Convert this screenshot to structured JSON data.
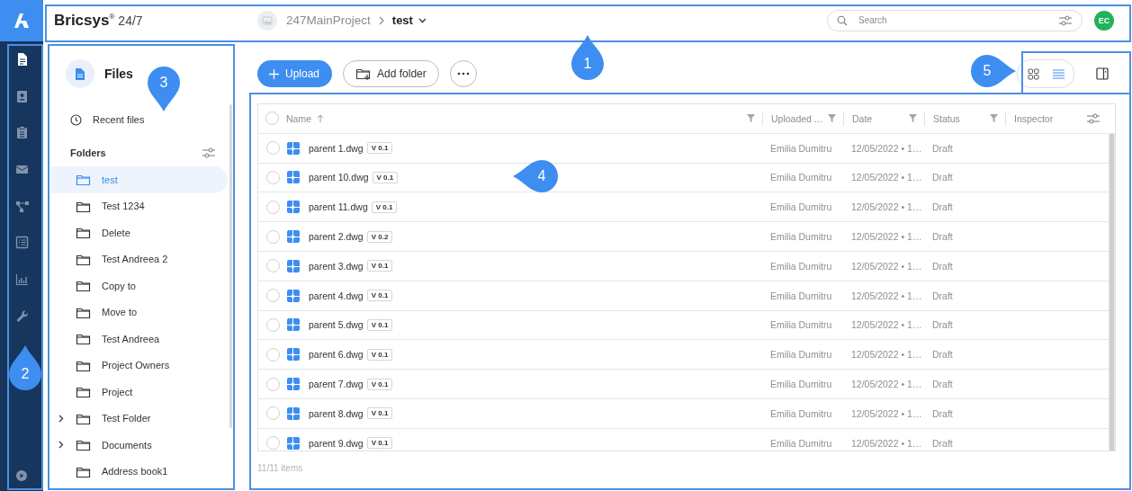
{
  "app": {
    "brand": "Bricsys",
    "brand_mark": "®",
    "product": "24/7"
  },
  "breadcrumb": {
    "project": "247MainProject",
    "current": "test"
  },
  "search": {
    "placeholder": "Search"
  },
  "user": {
    "initials": "EC"
  },
  "rail": [
    {
      "kind": "file",
      "selected": true
    },
    {
      "kind": "contact",
      "selected": false
    },
    {
      "kind": "clipboard",
      "selected": false
    },
    {
      "kind": "mail",
      "selected": false
    },
    {
      "kind": "network",
      "selected": false
    },
    {
      "kind": "list",
      "selected": false
    },
    {
      "kind": "chart",
      "selected": false
    },
    {
      "kind": "wrench",
      "selected": false
    }
  ],
  "sidebar": {
    "title": "Files",
    "recent": "Recent files",
    "folders_heading": "Folders",
    "folders": [
      {
        "label": "test",
        "selected": true,
        "expandable": false
      },
      {
        "label": "Test 1234",
        "selected": false,
        "expandable": false
      },
      {
        "label": "Delete",
        "selected": false,
        "expandable": false
      },
      {
        "label": "Test Andreea 2",
        "selected": false,
        "expandable": false
      },
      {
        "label": "Copy to",
        "selected": false,
        "expandable": false
      },
      {
        "label": "Move to",
        "selected": false,
        "expandable": false
      },
      {
        "label": "Test Andreea",
        "selected": false,
        "expandable": false
      },
      {
        "label": "Project Owners",
        "selected": false,
        "expandable": false
      },
      {
        "label": "Project",
        "selected": false,
        "expandable": false
      },
      {
        "label": "Test Folder",
        "selected": false,
        "expandable": true
      },
      {
        "label": "Documents",
        "selected": false,
        "expandable": true
      },
      {
        "label": "Address book1",
        "selected": false,
        "expandable": false
      }
    ]
  },
  "toolbar": {
    "upload": "Upload",
    "add_folder": "Add folder"
  },
  "view_toggle": [
    {
      "kind": "grid",
      "selected": false
    },
    {
      "kind": "list",
      "selected": true
    }
  ],
  "table": {
    "all_checked": false,
    "columns": [
      {
        "label": "Name",
        "sorted": true,
        "filterable": true
      },
      {
        "label": "Uploaded ...",
        "sorted": false,
        "filterable": true
      },
      {
        "label": "Date",
        "sorted": false,
        "filterable": true
      },
      {
        "label": "Status",
        "sorted": false,
        "filterable": true
      },
      {
        "label": "Inspector",
        "sorted": false,
        "filterable": false
      }
    ],
    "rows": [
      {
        "checked": false,
        "name": "parent 1.dwg",
        "version": "V 0.1",
        "uploaded_by": "Emilia Dumitru",
        "date": "12/05/2022 • 1…",
        "status": "Draft"
      },
      {
        "checked": false,
        "name": "parent 10.dwg",
        "version": "V 0.1",
        "uploaded_by": "Emilia Dumitru",
        "date": "12/05/2022 • 1…",
        "status": "Draft"
      },
      {
        "checked": false,
        "name": "parent 11.dwg",
        "version": "V 0.1",
        "uploaded_by": "Emilia Dumitru",
        "date": "12/05/2022 • 1…",
        "status": "Draft"
      },
      {
        "checked": false,
        "name": "parent 2.dwg",
        "version": "V 0.2",
        "uploaded_by": "Emilia Dumitru",
        "date": "12/05/2022 • 1…",
        "status": "Draft"
      },
      {
        "checked": false,
        "name": "parent 3.dwg",
        "version": "V 0.1",
        "uploaded_by": "Emilia Dumitru",
        "date": "12/05/2022 • 1…",
        "status": "Draft"
      },
      {
        "checked": false,
        "name": "parent 4.dwg",
        "version": "V 0.1",
        "uploaded_by": "Emilia Dumitru",
        "date": "12/05/2022 • 1…",
        "status": "Draft"
      },
      {
        "checked": false,
        "name": "parent 5.dwg",
        "version": "V 0.1",
        "uploaded_by": "Emilia Dumitru",
        "date": "12/05/2022 • 1…",
        "status": "Draft"
      },
      {
        "checked": false,
        "name": "parent 6.dwg",
        "version": "V 0.1",
        "uploaded_by": "Emilia Dumitru",
        "date": "12/05/2022 • 1…",
        "status": "Draft"
      },
      {
        "checked": false,
        "name": "parent 7.dwg",
        "version": "V 0.1",
        "uploaded_by": "Emilia Dumitru",
        "date": "12/05/2022 • 1…",
        "status": "Draft"
      },
      {
        "checked": false,
        "name": "parent 8.dwg",
        "version": "V 0.1",
        "uploaded_by": "Emilia Dumitru",
        "date": "12/05/2022 • 1…",
        "status": "Draft"
      },
      {
        "checked": false,
        "name": "parent 9.dwg",
        "version": "V 0.1",
        "uploaded_by": "Emilia Dumitru",
        "date": "12/05/2022 • 1…",
        "status": "Draft"
      }
    ]
  },
  "footer": "11/11 items",
  "callouts": [
    {
      "label": "1",
      "kind": "up"
    },
    {
      "label": "2",
      "kind": "up"
    },
    {
      "label": "3",
      "kind": "down"
    },
    {
      "label": "4",
      "kind": "left"
    },
    {
      "label": "5",
      "kind": "right"
    }
  ]
}
